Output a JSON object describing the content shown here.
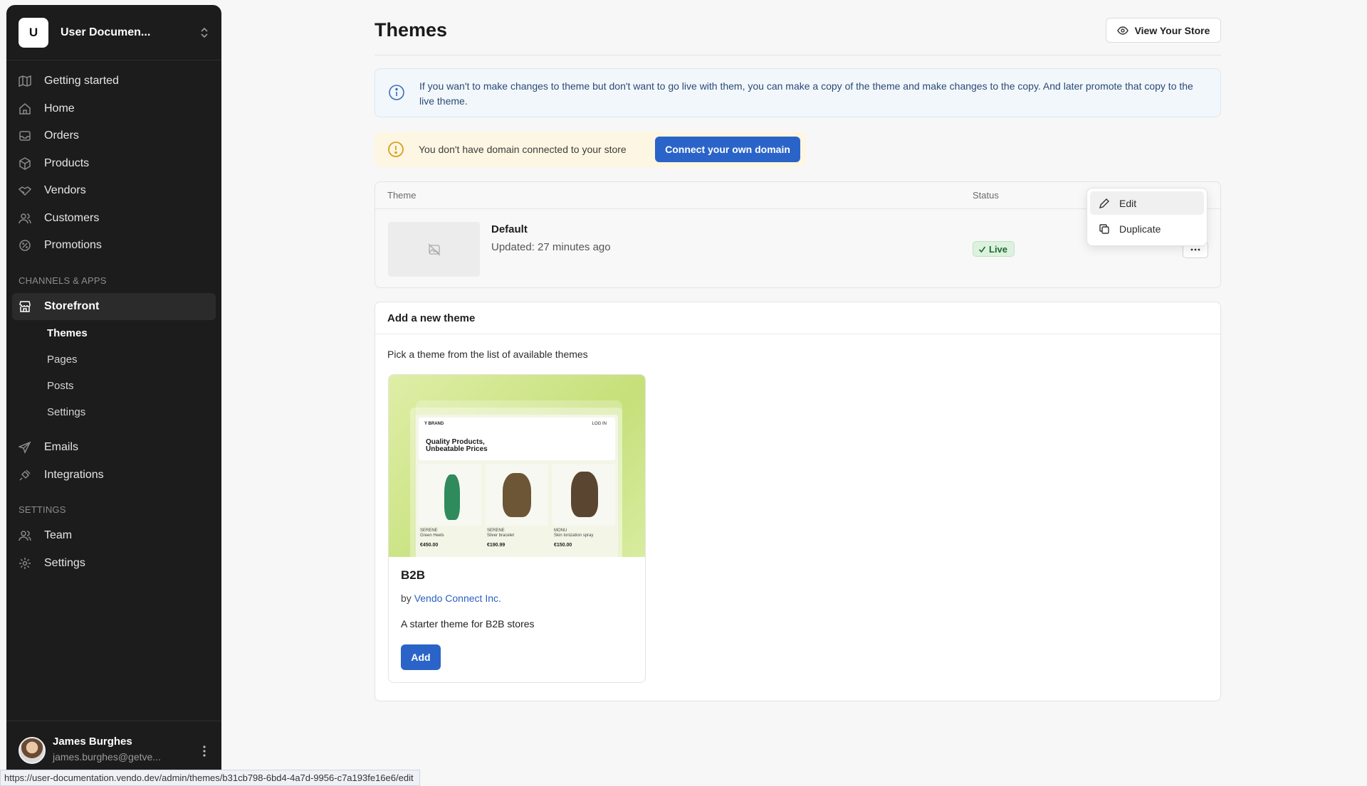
{
  "store": {
    "initial": "U",
    "name": "User Documen..."
  },
  "nav": {
    "items": [
      {
        "label": "Getting started",
        "icon": "map-icon"
      },
      {
        "label": "Home",
        "icon": "home-icon"
      },
      {
        "label": "Orders",
        "icon": "inbox-icon"
      },
      {
        "label": "Products",
        "icon": "box-icon"
      },
      {
        "label": "Vendors",
        "icon": "handshake-icon"
      },
      {
        "label": "Customers",
        "icon": "users-icon"
      },
      {
        "label": "Promotions",
        "icon": "badge-percent-icon"
      }
    ],
    "channels_label": "CHANNELS & APPS",
    "storefront_label": "Storefront",
    "storefront_sub": [
      "Themes",
      "Pages",
      "Posts",
      "Settings"
    ],
    "more_items": [
      {
        "label": "Emails",
        "icon": "send-icon"
      },
      {
        "label": "Integrations",
        "icon": "plug-icon"
      }
    ],
    "settings_label": "SETTINGS",
    "settings_items": [
      {
        "label": "Team",
        "icon": "users-icon"
      },
      {
        "label": "Settings",
        "icon": "gear-icon"
      }
    ]
  },
  "user": {
    "name": "James Burghes",
    "email": "james.burghes@getve..."
  },
  "status_url": "https://user-documentation.vendo.dev/admin/themes/b31cb798-6bd4-4a7d-9956-c7a193fe16e6/edit",
  "header": {
    "title": "Themes",
    "view_store_label": "View Your Store"
  },
  "info_banner": "If you wan't to make changes to theme but don't want to go live with them, you can make a copy of the theme and make changes to the copy. And later promote that copy to the live theme.",
  "warning_banner": {
    "text": "You don't have domain connected to your store",
    "button": "Connect your own domain"
  },
  "themes_table": {
    "columns": [
      "Theme",
      "Status"
    ],
    "rows": [
      {
        "name": "Default",
        "updated": "Updated: 27 minutes ago",
        "status": "Live"
      }
    ]
  },
  "row_menu": {
    "items": [
      "Edit",
      "Duplicate"
    ]
  },
  "add_theme": {
    "title": "Add a new theme",
    "subtitle": "Pick a theme from the list of available themes",
    "cards": [
      {
        "name": "B2B",
        "by_prefix": "by",
        "author": "Vendo Connect Inc.",
        "description": "A starter theme for B2B stores",
        "button": "Add",
        "preview": {
          "brand": "Y BRAND",
          "login": "LOG IN",
          "headline": "Quality Products, Unbeatable Prices",
          "products": [
            {
              "vendor": "SERENE",
              "name": "Green Heels",
              "price": "€450.00"
            },
            {
              "vendor": "SERENE",
              "name": "Silver bracelet",
              "price": "€190.99"
            },
            {
              "vendor": "MONU",
              "name": "Skin Ionization spray",
              "price": "€150.00"
            }
          ]
        }
      }
    ]
  },
  "colors": {
    "accent": "#2b64c8",
    "sidebar": "#1c1c1c",
    "live_badge": "#dcf2de",
    "warning_bg": "#fdf6e3",
    "info_bg": "#f2f7fc"
  }
}
